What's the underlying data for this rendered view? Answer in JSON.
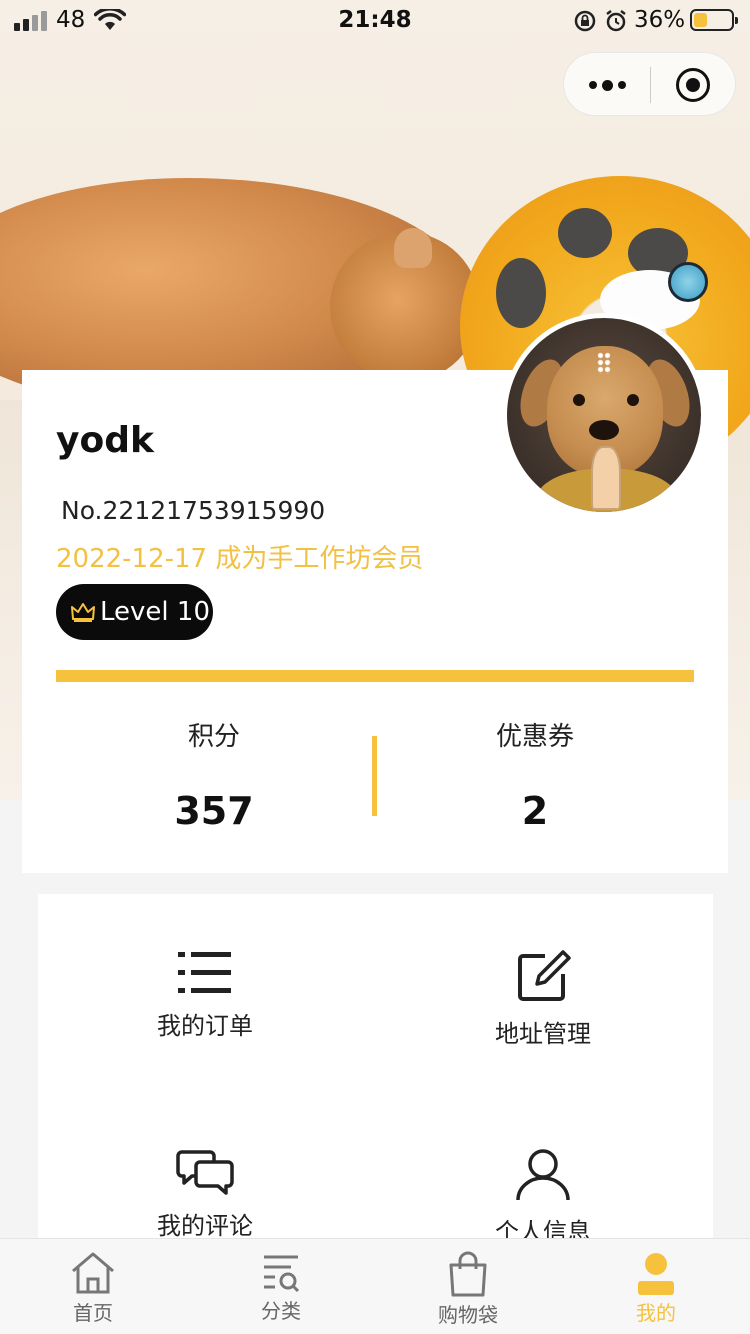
{
  "status_bar": {
    "carrier": "48",
    "time": "21:48",
    "battery_percent": "36%",
    "battery_level": 0.36,
    "battery_color": "#f6c23e"
  },
  "capsule": {
    "more_icon": "more-dots-icon",
    "close_icon": "target-close-icon"
  },
  "profile": {
    "username": "yodk",
    "member_no": "No.22121753915990",
    "join_text": "2022-12-17 成为手工作坊会员",
    "level": "Level 10",
    "level_icon": "crown-icon",
    "progress": 1.0,
    "accent_color": "#f6c23e"
  },
  "stats": {
    "points_label": "积分",
    "points_value": "357",
    "coupons_label": "优惠券",
    "coupons_value": "2"
  },
  "menu": {
    "orders": {
      "label": "我的订单",
      "icon": "list-icon"
    },
    "address": {
      "label": "地址管理",
      "icon": "edit-icon"
    },
    "reviews": {
      "label": "我的评论",
      "icon": "chat-bubbles-icon"
    },
    "profile": {
      "label": "个人信息",
      "icon": "user-icon"
    }
  },
  "tab_bar": {
    "home": {
      "label": "首页",
      "icon": "home-icon"
    },
    "category": {
      "label": "分类",
      "icon": "category-search-icon"
    },
    "bag": {
      "label": "购物袋",
      "icon": "shopping-bag-icon"
    },
    "mine": {
      "label": "我的",
      "icon": "person-icon",
      "active": true
    }
  }
}
